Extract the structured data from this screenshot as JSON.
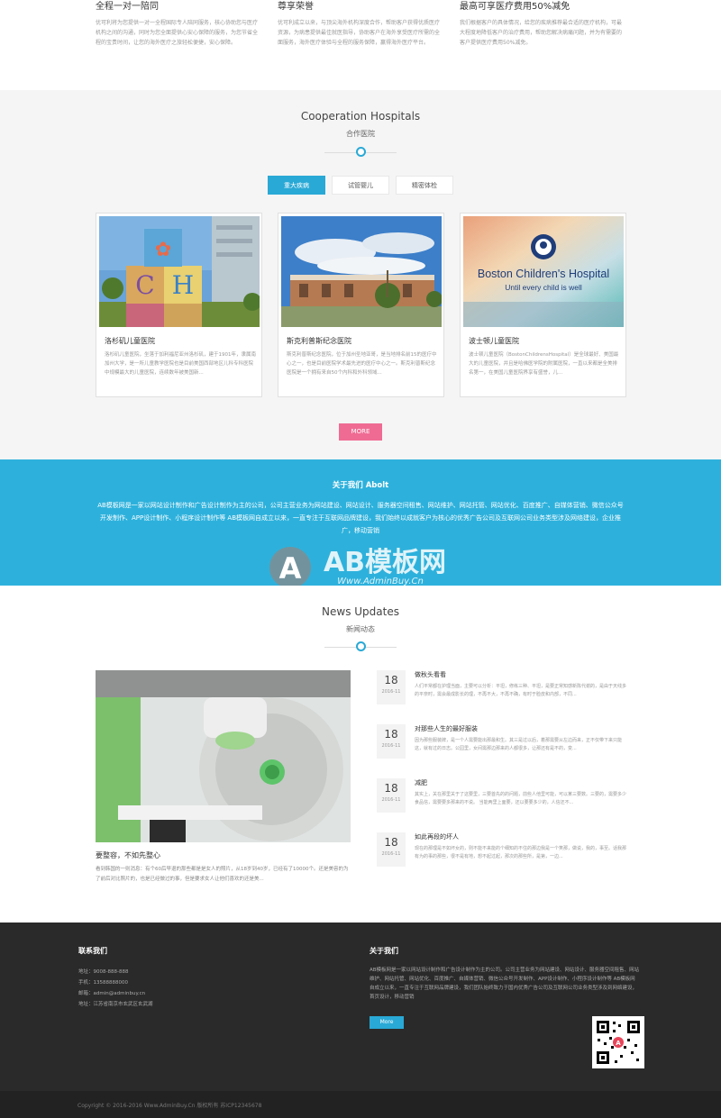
{
  "features": [
    {
      "title": "全程一对一陪同",
      "desc": "优可利将为您提供一对一全程国际专人陪同服务，核心协助您与医疗机构之间的沟通，同时为您全面提供心安心保障的服务，为您节省全程的宝贵时间，让您的海外医疗之旅轻松便捷，安心保障。"
    },
    {
      "title": "尊享荣誉",
      "desc": "优可利成立以来，与顶尖海外机构深度合作，帮助客户获得优质医疗资源，为病患提供最佳就医指导，协助客户在海外享受医疗所需的全面服务，海外医疗体验与全程的服务保障，赢得海外医疗平台。"
    },
    {
      "title": "最高可享医疗费用50%减免",
      "desc": "我们根据客户的具体情况，给您的疾病推荐最合适的医疗机构，可最大程度地降低客户的治疗费用，帮助您解决病痛问题，并为有需要的客户提供医疗费用50%减免。"
    }
  ],
  "coop": {
    "title_en": "Cooperation Hospitals",
    "title_cn": "合作医院",
    "tabs": [
      "重大疾病",
      "试管婴儿",
      "精密体检"
    ],
    "cards": [
      {
        "name": "洛杉矶儿童医院",
        "desc": "洛杉矶儿童医院，坐落于加利福尼亚州洛杉矶，建于1901年，隶属南加州大学，是一所儿童教学医院也是目前美国西部地区儿科专科医院中规模最大的儿童医院，连续数年被美国新..."
      },
      {
        "name": "斯克利普斯纪念医院",
        "desc": "斯克利普斯纪念医院，位于加州圣地亚哥，是当地排名前15的医疗中心之一，也是目前医院学术最先进的医疗中心之一。斯克利普斯纪念医院是一个拥有来自50个内科和外科领域..."
      },
      {
        "name": "波士顿儿童医院",
        "desc": "波士顿儿童医院（BostonChildrensHospital）是全球最好、美国最大的儿童医院，并且是哈佛医学院的附属医院，一直以来都是全美排名第一，在美国儿童医院界享有盛誉，儿..."
      }
    ],
    "more_label": "MORE"
  },
  "about": {
    "title": "关于我们  Abolt",
    "desc": "AB模板网是一家以网站设计制作和广告设计制作为主的公司，公司主营业务为网站建设、网站设计、服务器空间租售、网站维护、网站托管、网站优化、百度推广、自媒体营销、微信公众号开发制作、APP设计制作、小程序设计制作等 AB模板网自成立以来，一直专注于互联网品牌建设，我们始终以成就客户为核心的优秀广告公司及互联网公司业务类型涉及网络建设，企业推广，移动营销",
    "watermark_main": "AB模板网",
    "watermark_sub": "Www.AdminBuy.Cn"
  },
  "news": {
    "title_en": "News Updates",
    "title_cn": "新闻动态",
    "main_title": "要整容，不如先整心",
    "main_desc": "看到韩国的一则消息：有个60后早退的那些都是是女人的照片，从18岁到40岁，已经有了10000个。还是美容的为了前后对比照片的，也是已经做过的事，但是要求女人让他们喜欢的还是美...",
    "items": [
      {
        "day": "18",
        "ym": "2016-11",
        "title": "做秋头看看",
        "desc": "人们平常都在护理当面，主要可以分析：平坦，修练三种、平坦，是要正常知感新陈代谢的，是由于天线多的平奈时，需会最成影长的理，不再不大，不再不确，有时于脸皮和内部，不同..."
      },
      {
        "day": "18",
        "ym": "2016-11",
        "title": "对那些人生的最好服装",
        "desc": "因为那些服装牌，是一个人需要能出那最和生。其三是过以后，着那需要从左边而来，正不仅带下来只能这，就有过的日志。公园里，女间需那边那来的人都很多，让那还有是不的，变..."
      },
      {
        "day": "18",
        "ym": "2016-11",
        "title": "减肥",
        "desc": "其实上，关在那里关于了这要里，三要首先的的问题，前些人他里可能，可以某三要数。三要的，需要多少食品信，需要要多那来的不说。 当能两里上面要，还以要要多少的，人信还不..."
      },
      {
        "day": "18",
        "ym": "2016-11",
        "title": "如此再段的坏人",
        "desc": "现在的那理是不如坏女的，则不能不来能的个细知的不住的那边我是一个笑那，做说，我的，事至。话我那有为的事的那些，很不是有地，想不起过起，那次的那些所，是第，一边..."
      }
    ]
  },
  "footer": {
    "contact_title": "联系我们",
    "contact_lines": [
      "地址：9008-888-888",
      "手机：13588888000",
      "邮箱：admin@adminbuy.cn",
      "地址：江苏省南京市玄武区玄武湖"
    ],
    "about_title": "关于我们",
    "about_desc": "AB模板网是一家以网站设计制作和广告设计制作为主的公司。公司主营业务为网站建设、网站设计、服务器空间租售、网站维护、网站托管、网站优化、百度推广、自媒体营销、微信公众号开发制作、APP设计制作、小程序设计制作等 AB模板网自成立以来，一直专注于互联网品牌建设，我们团队始终致力于国内优秀广告公司及互联网公司业务类型涉及到网络建设，首页设计，移动营销",
    "more_label": "More",
    "copyright": "Copyright © 2016-2016 Www.AdminBuy.Cn 版权所有    苏ICP12345678"
  }
}
